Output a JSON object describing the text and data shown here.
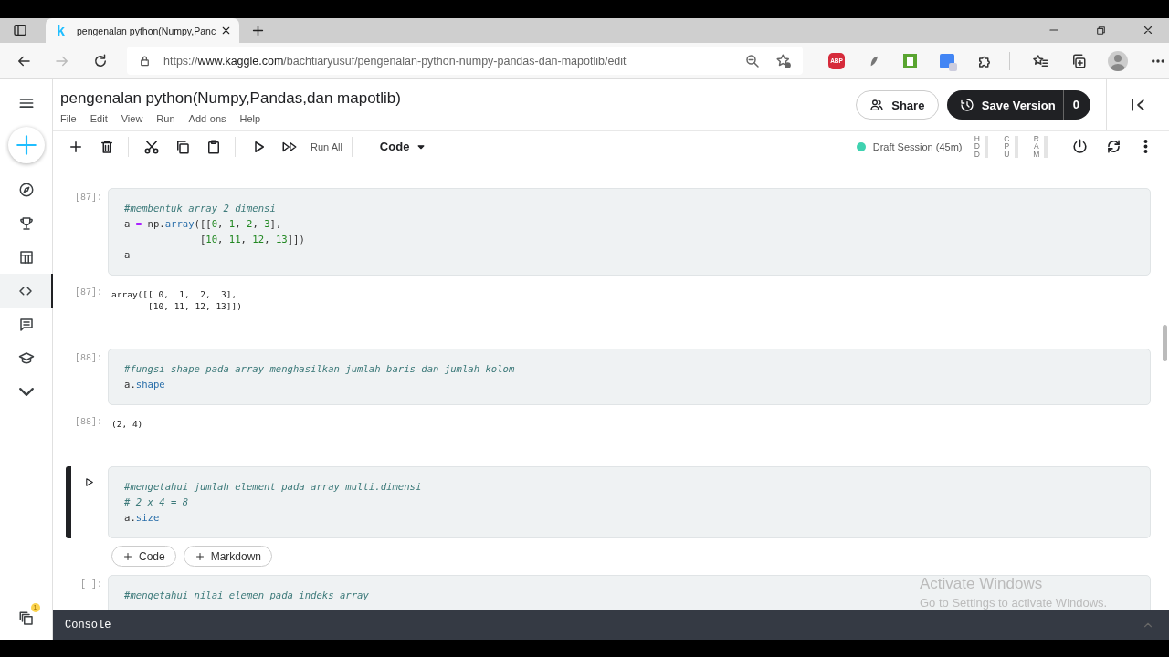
{
  "browser": {
    "tab": {
      "logo_text": "k",
      "title": "pengenalan python(Numpy,Panc",
      "selected": true
    },
    "url": {
      "scheme": "https://",
      "host": "www.kaggle.com",
      "path": "/bachtiaryusuf/pengenalan-python-numpy-pandas-dan-mapotlib/edit"
    },
    "adblock_label": "ABP"
  },
  "notebook": {
    "title": "pengenalan python(Numpy,Pandas,dan mapotlib)",
    "menu": [
      "File",
      "Edit",
      "View",
      "Run",
      "Add-ons",
      "Help"
    ],
    "share_label": "Share",
    "save_label": "Save Version",
    "save_count": "0"
  },
  "sidebar": {
    "items": [
      {
        "selected": false
      },
      {
        "selected": false
      },
      {
        "selected": false
      },
      {
        "selected": true
      },
      {
        "selected": false
      },
      {
        "selected": false
      },
      {
        "selected": false
      }
    ],
    "badge": "1"
  },
  "toolbar": {
    "run_all": "Run All",
    "cell_type": "Code",
    "session": {
      "label": "Draft Session (45m)",
      "color": "#3fd2b0"
    },
    "resources": [
      "HDD",
      "CPU",
      "RAM"
    ]
  },
  "cells": [
    {
      "kind": "input",
      "prompt": "[87]:",
      "selected": false,
      "lines": [
        [
          {
            "kind": "comment",
            "t": "#membentuk array 2 dimensi"
          }
        ],
        [
          {
            "kind": "name",
            "t": "a "
          },
          {
            "kind": "op",
            "t": "="
          },
          {
            "kind": "name",
            "t": " np."
          },
          {
            "kind": "attr",
            "t": "array"
          },
          {
            "kind": "name",
            "t": "([["
          },
          {
            "kind": "num",
            "t": "0"
          },
          {
            "kind": "name",
            "t": ", "
          },
          {
            "kind": "num",
            "t": "1"
          },
          {
            "kind": "name",
            "t": ", "
          },
          {
            "kind": "num",
            "t": "2"
          },
          {
            "kind": "name",
            "t": ", "
          },
          {
            "kind": "num",
            "t": "3"
          },
          {
            "kind": "name",
            "t": "],"
          }
        ],
        [
          {
            "kind": "name",
            "t": "             ["
          },
          {
            "kind": "num",
            "t": "10"
          },
          {
            "kind": "name",
            "t": ", "
          },
          {
            "kind": "num",
            "t": "11"
          },
          {
            "kind": "name",
            "t": ", "
          },
          {
            "kind": "num",
            "t": "12"
          },
          {
            "kind": "name",
            "t": ", "
          },
          {
            "kind": "num",
            "t": "13"
          },
          {
            "kind": "name",
            "t": "]])"
          }
        ],
        [
          {
            "kind": "name",
            "t": "a"
          }
        ]
      ]
    },
    {
      "kind": "output",
      "prompt": "[87]:",
      "text": "array([[ 0,  1,  2,  3],\n       [10, 11, 12, 13]])"
    },
    {
      "kind": "input",
      "prompt": "[88]:",
      "selected": false,
      "lines": [
        [
          {
            "kind": "comment",
            "t": "#fungsi shape pada array menghasilkan jumlah baris dan jumlah kolom"
          }
        ],
        [
          {
            "kind": "name",
            "t": "a."
          },
          {
            "kind": "attr",
            "t": "shape"
          }
        ]
      ]
    },
    {
      "kind": "output",
      "prompt": "[88]:",
      "text": "(2, 4)"
    },
    {
      "kind": "input",
      "selected": true,
      "lines": [
        [
          {
            "kind": "comment",
            "t": "#mengetahui jumlah element pada array multi.dimensi"
          }
        ],
        [
          {
            "kind": "comment",
            "t": "# 2 x 4 = 8"
          }
        ],
        [
          {
            "kind": "name",
            "t": "a."
          },
          {
            "kind": "attr",
            "t": "size"
          }
        ]
      ]
    },
    {
      "kind": "add",
      "buttons": [
        "Code",
        "Markdown"
      ]
    },
    {
      "kind": "input",
      "prompt": "[ ]:",
      "selected": false,
      "lines": [
        [
          {
            "kind": "comment",
            "t": "#mengetahui nilai elemen pada indeks array"
          }
        ]
      ]
    }
  ],
  "console": {
    "label": "Console"
  },
  "os_notice": {
    "title": "Activate Windows",
    "text": "Go to Settings to activate Windows."
  }
}
